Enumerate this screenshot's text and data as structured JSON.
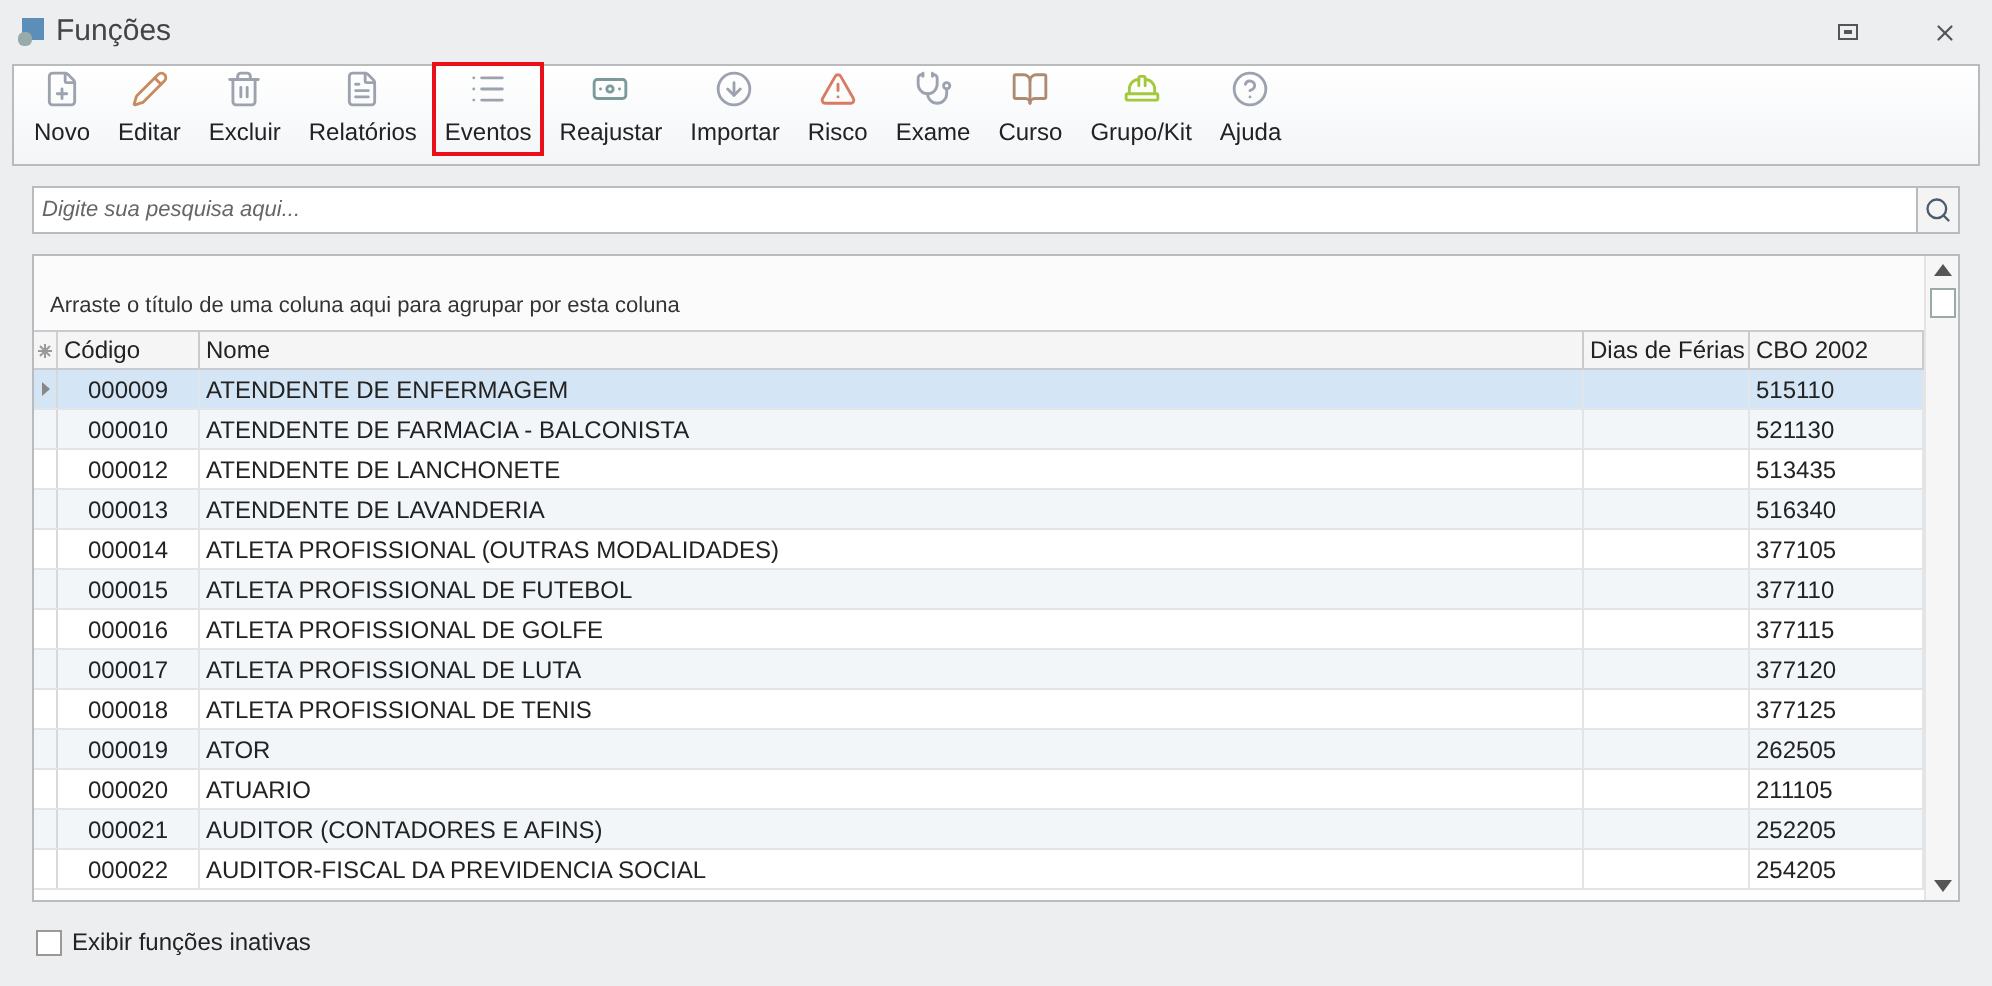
{
  "window": {
    "title": "Funções"
  },
  "toolbar": [
    {
      "label": "Novo",
      "kind": "new",
      "highlighted": false
    },
    {
      "label": "Editar",
      "kind": "edit",
      "highlighted": false
    },
    {
      "label": "Excluir",
      "kind": "delete",
      "highlighted": false
    },
    {
      "label": "Relatórios",
      "kind": "reports",
      "highlighted": false
    },
    {
      "label": "Eventos",
      "kind": "events",
      "highlighted": true
    },
    {
      "label": "Reajustar",
      "kind": "money",
      "highlighted": false
    },
    {
      "label": "Importar",
      "kind": "import",
      "highlighted": false
    },
    {
      "label": "Risco",
      "kind": "risk",
      "highlighted": false
    },
    {
      "label": "Exame",
      "kind": "exam",
      "highlighted": false
    },
    {
      "label": "Curso",
      "kind": "course",
      "highlighted": false
    },
    {
      "label": "Grupo/Kit",
      "kind": "kit",
      "highlighted": false
    },
    {
      "label": "Ajuda",
      "kind": "help",
      "highlighted": false
    }
  ],
  "search": {
    "placeholder": "Digite sua pesquisa aqui..."
  },
  "group_hint": "Arraste o título de uma coluna aqui para agrupar por esta coluna",
  "table": {
    "columns": [
      "Código",
      "Nome",
      "Dias de Férias",
      "CBO 2002"
    ],
    "rows": [
      {
        "cells": [
          "000009",
          "ATENDENTE DE ENFERMAGEM",
          "",
          "515110"
        ],
        "selected": true
      },
      {
        "cells": [
          "000010",
          "ATENDENTE DE FARMACIA - BALCONISTA",
          "",
          "521130"
        ],
        "selected": false
      },
      {
        "cells": [
          "000012",
          "ATENDENTE DE LANCHONETE",
          "",
          "513435"
        ],
        "selected": false
      },
      {
        "cells": [
          "000013",
          "ATENDENTE DE LAVANDERIA",
          "",
          "516340"
        ],
        "selected": false
      },
      {
        "cells": [
          "000014",
          "ATLETA PROFISSIONAL (OUTRAS MODALIDADES)",
          "",
          "377105"
        ],
        "selected": false
      },
      {
        "cells": [
          "000015",
          "ATLETA PROFISSIONAL DE FUTEBOL",
          "",
          "377110"
        ],
        "selected": false
      },
      {
        "cells": [
          "000016",
          "ATLETA PROFISSIONAL DE GOLFE",
          "",
          "377115"
        ],
        "selected": false
      },
      {
        "cells": [
          "000017",
          "ATLETA PROFISSIONAL DE LUTA",
          "",
          "377120"
        ],
        "selected": false
      },
      {
        "cells": [
          "000018",
          "ATLETA PROFISSIONAL DE TENIS",
          "",
          "377125"
        ],
        "selected": false
      },
      {
        "cells": [
          "000019",
          "ATOR",
          "",
          "262505"
        ],
        "selected": false
      },
      {
        "cells": [
          "000020",
          "ATUARIO",
          "",
          "211105"
        ],
        "selected": false
      },
      {
        "cells": [
          "000021",
          "AUDITOR (CONTADORES E AFINS)",
          "",
          "252205"
        ],
        "selected": false
      },
      {
        "cells": [
          "000022",
          "AUDITOR-FISCAL DA PREVIDENCIA SOCIAL",
          "",
          "254205"
        ],
        "selected": false
      }
    ]
  },
  "show_inactive": {
    "label": "Exibir funções inativas",
    "checked": false
  }
}
